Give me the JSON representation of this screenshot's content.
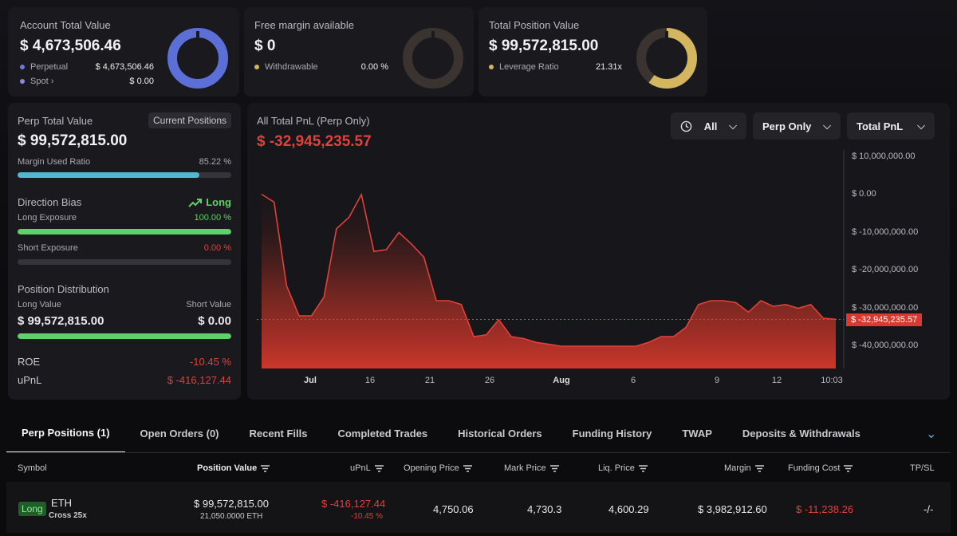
{
  "summary": {
    "account": {
      "label": "Account Total Value",
      "value": "$ 4,673,506.46",
      "rows": [
        {
          "label": "Perpetual",
          "value": "$ 4,673,506.46"
        },
        {
          "label": "Spot",
          "value": "$ 0.00"
        }
      ],
      "donut_fraction": 1.0,
      "donut_color": "#5b6fd6"
    },
    "margin": {
      "label": "Free margin available",
      "value": "$ 0",
      "rows": [
        {
          "label": "Withdrawable",
          "value": "0.00 %"
        }
      ],
      "donut_fraction": 0.0,
      "donut_color": "#3a3330"
    },
    "position": {
      "label": "Total Position Value",
      "value": "$ 99,572,815.00",
      "rows": [
        {
          "label": "Leverage Ratio",
          "value": "21.31x"
        }
      ],
      "donut_fraction": 0.6,
      "donut_color": "#d4b661"
    }
  },
  "perp": {
    "title": "Perp Total Value",
    "current_positions": "Current Positions",
    "value": "$ 99,572,815.00",
    "margin_used_label": "Margin Used Ratio",
    "margin_used_value": "85.22 %",
    "margin_used_fraction": 0.8522,
    "direction_bias_label": "Direction Bias",
    "direction_bias_value": "Long",
    "long_exposure_label": "Long Exposure",
    "long_exposure_value": "100.00 %",
    "long_exposure_fraction": 1.0,
    "short_exposure_label": "Short Exposure",
    "short_exposure_value": "0.00 %",
    "short_exposure_fraction": 0.0,
    "position_distribution_label": "Position Distribution",
    "long_value_label": "Long Value",
    "long_value": "$ 99,572,815.00",
    "short_value_label": "Short Value",
    "short_value": "$ 0.00",
    "distribution_long_fraction": 1.0,
    "roe_label": "ROE",
    "roe_value": "-10.45 %",
    "upnl_label": "uPnL",
    "upnl_value": "$ -416,127.44"
  },
  "pnl_panel": {
    "title": "All Total PnL (Perp Only)",
    "value": "$ -32,945,235.57",
    "filters": {
      "range": "All",
      "scope": "Perp Only",
      "metric": "Total PnL"
    },
    "current_label": "$ -32,945,235.57"
  },
  "chart_data": {
    "type": "area",
    "title": "All Total PnL (Perp Only)",
    "ylim": [
      -45000000,
      12000000
    ],
    "y_ticks": [
      {
        "value": 10000000,
        "label": "$ 10,000,000.00"
      },
      {
        "value": 0,
        "label": "$ 0.00"
      },
      {
        "value": -10000000,
        "label": "$ -10,000,000.00"
      },
      {
        "value": -20000000,
        "label": "$ -20,000,000.00"
      },
      {
        "value": -30000000,
        "label": "$ -30,000,000.00"
      },
      {
        "value": -40000000,
        "label": "$ -40,000,000.00"
      }
    ],
    "x_ticks": [
      "Jul",
      "16",
      "21",
      "26",
      "Aug",
      "6",
      "9",
      "12",
      "10:03"
    ],
    "series": [
      {
        "color": "#e0413a",
        "values": [
          0.1,
          -2,
          -24,
          -32,
          -32,
          -27,
          -9,
          -6,
          0,
          -15,
          -14.5,
          -10,
          -13,
          -16.5,
          -28,
          -28,
          -29,
          -37.5,
          -37,
          -33,
          -37.5,
          -38,
          -39,
          -39.5,
          -40,
          -40,
          -40,
          -40,
          -40,
          -40,
          -40,
          -39,
          -37.5,
          -37.5,
          -35,
          -29,
          -28,
          -28,
          -28.5,
          -31,
          -28,
          -29.5,
          -29,
          -30,
          -29,
          -32.6,
          -32.9
        ]
      }
    ],
    "current_value": -32945235.57
  },
  "tabs": [
    "Perp Positions (1)",
    "Open Orders (0)",
    "Recent Fills",
    "Completed Trades",
    "Historical Orders",
    "Funding History",
    "TWAP",
    "Deposits & Withdrawals"
  ],
  "table": {
    "headers": {
      "symbol": "Symbol",
      "position_value": "Position Value",
      "upnl": "uPnL",
      "opening_price": "Opening Price",
      "mark_price": "Mark Price",
      "liq_price": "Liq. Price",
      "margin": "Margin",
      "funding_cost": "Funding Cost",
      "tpsl": "TP/SL"
    },
    "row": {
      "side": "Long",
      "symbol": "ETH",
      "mode": "Cross 25x",
      "position_value": "$ 99,572,815.00",
      "position_size": "21,050.0000 ETH",
      "upnl": "$ -416,127.44",
      "upnl_pct": "-10.45 %",
      "opening_price": "4,750.06",
      "mark_price": "4,730.3",
      "liq_price": "4,600.29",
      "margin": "$ 3,982,912.60",
      "funding_cost": "$ -11,238.26",
      "tpsl": "-/-"
    }
  }
}
